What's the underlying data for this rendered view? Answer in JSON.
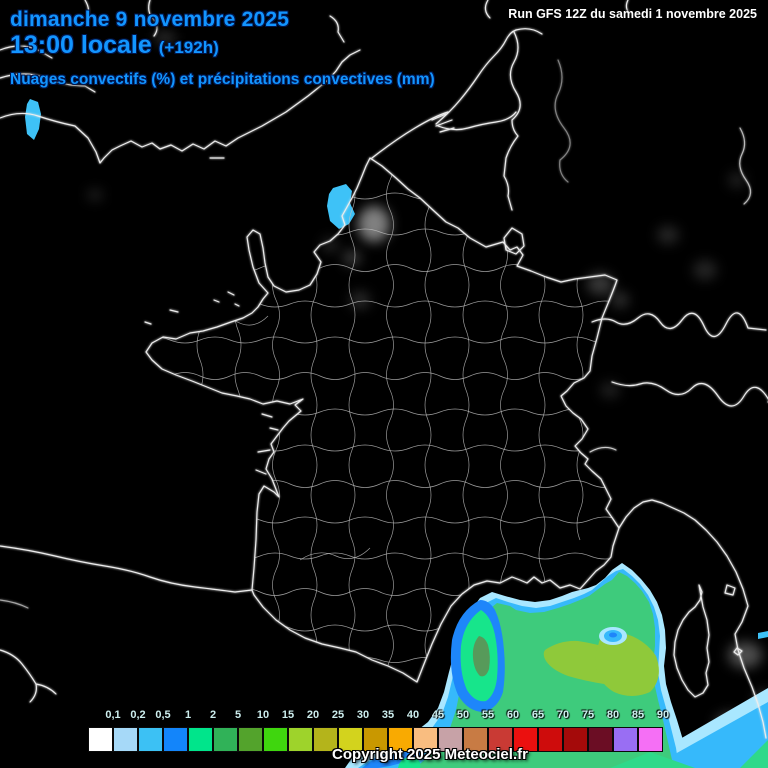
{
  "header": {
    "date": "dimanche 9 novembre 2025",
    "time": "13:00 locale",
    "offset": "(+192h)",
    "run": "Run GFS 12Z du samedi 1 novembre 2025",
    "subtitle": "Nuages convectifs (%) et précipitations convectives (mm)"
  },
  "footer": {
    "copyright": "Copyright 2025 Meteociel.fr"
  },
  "colors": {
    "background": "#000000",
    "title_blue": "#1295ff",
    "title_outline": "#00164d",
    "run_text": "#ffffff",
    "legend_label": "#cdeeee",
    "coastline": "#ededed",
    "department_line": "#c2c2c2",
    "precip_layers": [
      "#a9e7ff",
      "#36b9fb",
      "#1e86fa",
      "#3ecb7c",
      "#17e58b",
      "#579a5a",
      "#8fc93a"
    ]
  },
  "legend": {
    "items": [
      {
        "label": "0,1",
        "color": "#ffffff"
      },
      {
        "label": "0,2",
        "color": "#a6d9f8"
      },
      {
        "label": "0,5",
        "color": "#3cc1f4"
      },
      {
        "label": "1",
        "color": "#1385fa"
      },
      {
        "label": "2",
        "color": "#00e58b"
      },
      {
        "label": "5",
        "color": "#30b258"
      },
      {
        "label": "10",
        "color": "#53a32c"
      },
      {
        "label": "15",
        "color": "#3fd60e"
      },
      {
        "label": "20",
        "color": "#9ed32b"
      },
      {
        "label": "25",
        "color": "#b4b41b"
      },
      {
        "label": "30",
        "color": "#d3d31d"
      },
      {
        "label": "35",
        "color": "#c99800"
      },
      {
        "label": "40",
        "color": "#f9aa01"
      },
      {
        "label": "45",
        "color": "#f9bd80"
      },
      {
        "label": "50",
        "color": "#c7a2a7"
      },
      {
        "label": "55",
        "color": "#c87b44"
      },
      {
        "label": "60",
        "color": "#c93a34"
      },
      {
        "label": "65",
        "color": "#eb100f"
      },
      {
        "label": "70",
        "color": "#ce0c0c"
      },
      {
        "label": "75",
        "color": "#a40a0a"
      },
      {
        "label": "80",
        "color": "#6b0d24"
      },
      {
        "label": "85",
        "color": "#996ef3"
      },
      {
        "label": "90",
        "color": "#f56ff5"
      }
    ]
  }
}
